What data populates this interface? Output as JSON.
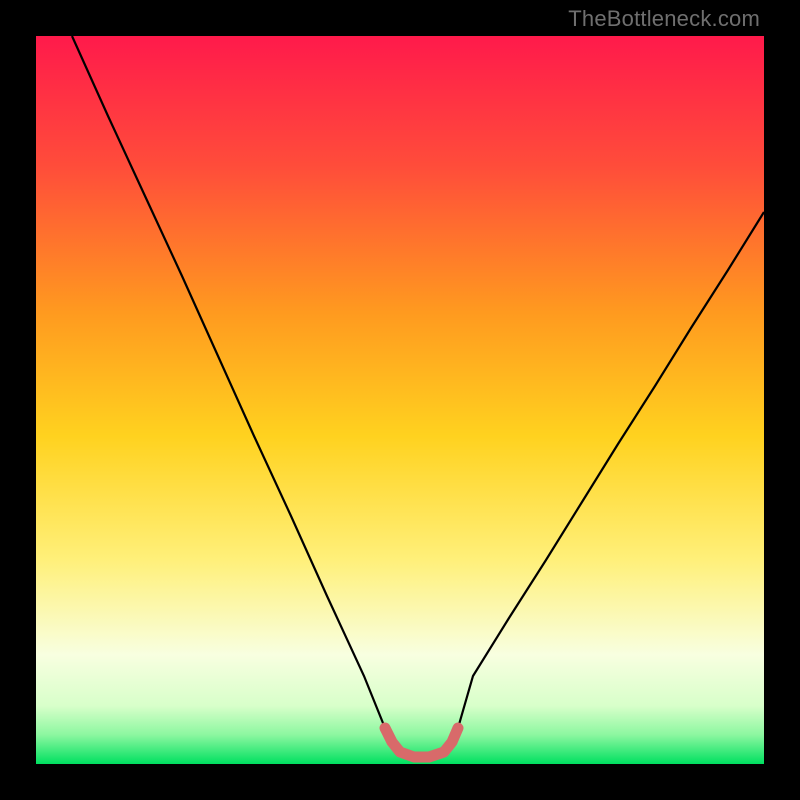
{
  "watermark": "TheBottleneck.com",
  "colors": {
    "frame": "#000000",
    "gradient_top": "#ff1a4b",
    "gradient_mid_upper": "#ff7a2a",
    "gradient_mid": "#ffd21f",
    "gradient_lower": "#fff07a",
    "gradient_pale": "#f8ffe0",
    "gradient_bottom": "#00e060",
    "curve": "#000000",
    "highlight": "#d86a6a"
  },
  "chart_data": {
    "type": "line",
    "title": "",
    "xlabel": "",
    "ylabel": "",
    "xlim": [
      0,
      100
    ],
    "ylim": [
      0,
      100
    ],
    "series": [
      {
        "name": "bottleneck-curve",
        "x": [
          5,
          10,
          15,
          20,
          25,
          30,
          35,
          40,
          45,
          48,
          50,
          52,
          54,
          56,
          58,
          60,
          65,
          70,
          75,
          80,
          85,
          90,
          95,
          100
        ],
        "y": [
          100,
          89,
          78,
          67,
          56,
          45,
          34,
          23,
          12,
          5,
          2,
          1,
          1,
          1,
          2,
          5,
          12,
          20,
          28,
          36,
          44,
          52,
          60,
          68
        ]
      },
      {
        "name": "optimal-range-highlight",
        "x": [
          48,
          50,
          52,
          54,
          56,
          58
        ],
        "y": [
          5,
          2,
          1,
          1,
          2,
          5
        ]
      }
    ],
    "annotations": [
      {
        "text": "TheBottleneck.com",
        "position": "top-right"
      }
    ]
  }
}
